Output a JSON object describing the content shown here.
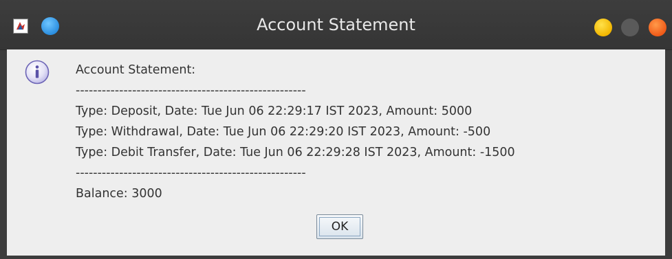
{
  "window": {
    "title": "Account Statement"
  },
  "dialog": {
    "icon": "info-icon",
    "message": {
      "heading": "Account Statement:",
      "separator_top": "-----------------------------------------------------",
      "transactions": [
        "Type: Deposit, Date: Tue Jun 06 22:29:17 IST 2023, Amount: 5000",
        "Type: Withdrawal, Date: Tue Jun 06 22:29:20 IST 2023, Amount: -500",
        "Type: Debit Transfer, Date: Tue Jun 06 22:29:28 IST 2023, Amount: -1500"
      ],
      "separator_bottom": "-----------------------------------------------------",
      "balance": "Balance: 3000"
    },
    "ok_label": "OK"
  },
  "colors": {
    "titlebar": "#3a3a3a",
    "content_bg": "#eeeeee",
    "text": "#333333",
    "minimize": "#f2b600",
    "close": "#f05a18"
  }
}
